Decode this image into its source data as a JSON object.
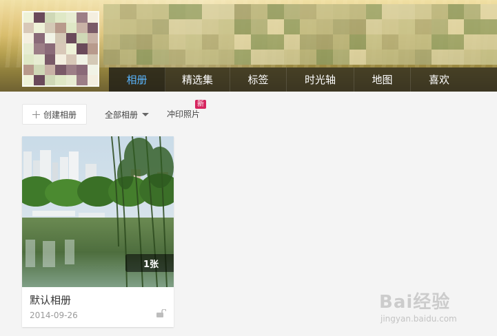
{
  "header": {
    "nav_tabs": [
      {
        "label": "相册",
        "active": true
      },
      {
        "label": "精选集",
        "active": false
      },
      {
        "label": "标签",
        "active": false
      },
      {
        "label": "时光轴",
        "active": false
      },
      {
        "label": "地图",
        "active": false
      },
      {
        "label": "喜欢",
        "active": false
      }
    ],
    "active_color": "#5ab6ff"
  },
  "toolbar": {
    "create_label": "创建相册",
    "filter_label": "全部相册",
    "print_label": "冲印照片",
    "new_badge": "新"
  },
  "albums": [
    {
      "title": "默认相册",
      "date": "2014-09-26",
      "count": "1张",
      "cover_icon": "lakeside-photo",
      "privacy_icon": "unlock-icon"
    }
  ],
  "watermark": {
    "main": "Bai经验",
    "sub": "jingyan.baidu.com"
  }
}
